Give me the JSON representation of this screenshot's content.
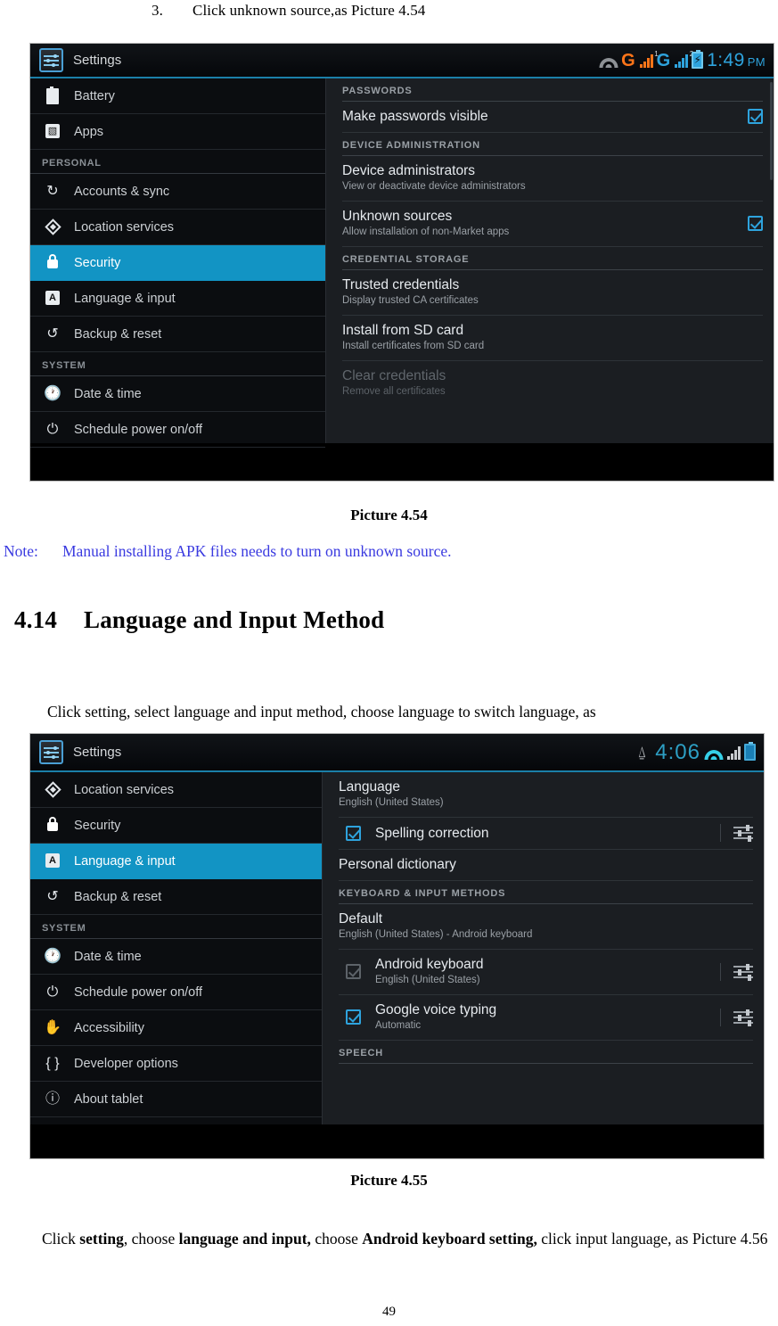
{
  "document": {
    "step": {
      "number": "3.",
      "text": "Click unknown source,as Picture 4.54"
    },
    "caption_454": "Picture 4.54",
    "note": {
      "label": "Note:",
      "text": "Manual installing APK files needs to turn on unknown source."
    },
    "section": {
      "number": "4.14",
      "title": "Language and Input Method"
    },
    "intro": "Click setting, select language and input method, choose language to switch language, as",
    "caption_455": "Picture 4.55",
    "closing": "Click setting, choose language and input, choose Android keyboard setting, click input language, as Picture 4.56",
    "closing_parts": {
      "p1": "Click ",
      "b1": "setting",
      "p2": ", choose ",
      "b2": "language and input,",
      "p3": " choose ",
      "b3": "Android keyboard setting,",
      "p4": " click input language, as Picture 4.56"
    },
    "page_number": "49"
  },
  "colors": {
    "accent_blue": "#1294c4",
    "status_blue": "#2ea3dd",
    "status_orange": "#ff7519",
    "note_blue": "#3a3ae0",
    "panel_bg": "#1b1e22",
    "sidebar_bg": "#0b0d10"
  },
  "screenshot_454": {
    "statusbar": {
      "app_icon": "settings-sliders-icon",
      "app_title": "Settings",
      "icons": [
        "wifi-icon",
        "gprs-g-orange-icon",
        "signal-bars-orange-icon",
        "gprs-g-blue-icon",
        "signal-bars-blue-icon",
        "battery-charging-icon"
      ],
      "gprs_label_1": "G",
      "gprs_label_2": "G",
      "signal_sup_1": "1",
      "signal_sup_2": "2",
      "time": "1:49",
      "ampm": "PM"
    },
    "sidebar": [
      {
        "type": "item",
        "icon": "battery-icon",
        "label": "Battery",
        "selected": false
      },
      {
        "type": "item",
        "icon": "apps-image-icon",
        "label": "Apps",
        "selected": false
      },
      {
        "type": "group",
        "label": "PERSONAL"
      },
      {
        "type": "item",
        "icon": "sync-icon",
        "label": "Accounts & sync",
        "selected": false
      },
      {
        "type": "item",
        "icon": "location-icon",
        "label": "Location services",
        "selected": false
      },
      {
        "type": "item",
        "icon": "lock-icon",
        "label": "Security",
        "selected": true
      },
      {
        "type": "item",
        "icon": "language-a-icon",
        "label": "Language & input",
        "selected": false
      },
      {
        "type": "item",
        "icon": "backup-restore-icon",
        "label": "Backup & reset",
        "selected": false
      },
      {
        "type": "group",
        "label": "SYSTEM"
      },
      {
        "type": "item",
        "icon": "clock-icon",
        "label": "Date & time",
        "selected": false
      },
      {
        "type": "item",
        "icon": "power-icon",
        "label": "Schedule power on/off",
        "selected": false
      }
    ],
    "content": [
      {
        "type": "group",
        "label": "PASSWORDS"
      },
      {
        "type": "row",
        "title": "Make passwords visible",
        "sub": "",
        "checkbox": "checked",
        "checkbox_side": "right"
      },
      {
        "type": "group",
        "label": "DEVICE ADMINISTRATION"
      },
      {
        "type": "row",
        "title": "Device administrators",
        "sub": "View or deactivate device administrators",
        "checkbox": "none"
      },
      {
        "type": "row",
        "title": "Unknown sources",
        "sub": "Allow installation of non-Market apps",
        "checkbox": "checked",
        "checkbox_side": "right"
      },
      {
        "type": "group",
        "label": "CREDENTIAL STORAGE"
      },
      {
        "type": "row",
        "title": "Trusted credentials",
        "sub": "Display trusted CA certificates",
        "checkbox": "none"
      },
      {
        "type": "row",
        "title": "Install from SD card",
        "sub": "Install certificates from SD card",
        "checkbox": "none"
      },
      {
        "type": "row",
        "title": "Clear credentials",
        "sub": "Remove all certificates",
        "checkbox": "none",
        "disabled": true
      }
    ]
  },
  "screenshot_455": {
    "statusbar": {
      "app_icon": "settings-sliders-icon",
      "app_title": "Settings",
      "icons": [
        "usb-icon",
        "wifi-icon",
        "signal-bars-icon",
        "battery-icon"
      ],
      "time": "4:06"
    },
    "sidebar": [
      {
        "type": "item",
        "icon": "location-icon",
        "label": "Location services",
        "selected": false
      },
      {
        "type": "item",
        "icon": "lock-icon",
        "label": "Security",
        "selected": false
      },
      {
        "type": "item",
        "icon": "language-a-icon",
        "label": "Language & input",
        "selected": true
      },
      {
        "type": "item",
        "icon": "backup-restore-icon",
        "label": "Backup & reset",
        "selected": false
      },
      {
        "type": "group",
        "label": "SYSTEM"
      },
      {
        "type": "item",
        "icon": "clock-icon",
        "label": "Date & time",
        "selected": false
      },
      {
        "type": "item",
        "icon": "power-icon",
        "label": "Schedule power on/off",
        "selected": false
      },
      {
        "type": "item",
        "icon": "accessibility-hand-icon",
        "label": "Accessibility",
        "selected": false
      },
      {
        "type": "item",
        "icon": "developer-braces-icon",
        "label": "Developer options",
        "selected": false
      },
      {
        "type": "item",
        "icon": "info-icon",
        "label": "About tablet",
        "selected": false
      }
    ],
    "content": [
      {
        "type": "row",
        "title": "Language",
        "sub": "English (United States)",
        "checkbox": "none"
      },
      {
        "type": "row",
        "title": "Spelling correction",
        "sub": "",
        "checkbox": "checked",
        "checkbox_side": "left",
        "tune": true
      },
      {
        "type": "row",
        "title": "Personal dictionary",
        "sub": "",
        "checkbox": "none"
      },
      {
        "type": "group",
        "label": "KEYBOARD & INPUT METHODS"
      },
      {
        "type": "row",
        "title": "Default",
        "sub": "English (United States) - Android keyboard",
        "checkbox": "none"
      },
      {
        "type": "row",
        "title": "Android keyboard",
        "sub": "English (United States)",
        "checkbox": "checked-gray",
        "checkbox_side": "left",
        "tune": true
      },
      {
        "type": "row",
        "title": "Google voice typing",
        "sub": "Automatic",
        "checkbox": "checked",
        "checkbox_side": "left",
        "tune": true
      },
      {
        "type": "group",
        "label": "SPEECH"
      }
    ]
  }
}
